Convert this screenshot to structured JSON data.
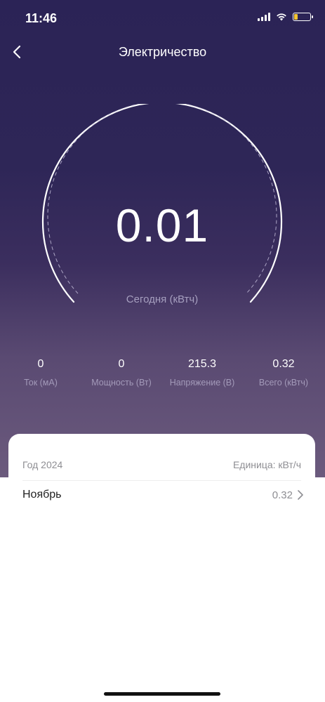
{
  "status_bar": {
    "time": "11:46",
    "icons": [
      "signal-icon",
      "wifi-icon",
      "battery-icon"
    ],
    "battery_color": "#f4c430"
  },
  "header": {
    "title": "Электричество",
    "back_icon": "chevron-left-icon"
  },
  "gauge": {
    "value": "0.01",
    "label": "Сегодня (кВтч)"
  },
  "stats": [
    {
      "value": "0",
      "label": "Ток (мА)"
    },
    {
      "value": "0",
      "label": "Мощность (Вт)"
    },
    {
      "value": "215.3",
      "label": "Напряжение (В)"
    },
    {
      "value": "0.32",
      "label": "Всего (кВтч)"
    }
  ],
  "card": {
    "year_label": "Год 2024",
    "unit_label": "Единица: кВт/ч",
    "rows": [
      {
        "label": "Ноябрь",
        "value": "0.32"
      }
    ]
  },
  "colors": {
    "background_top": "#2b2356",
    "background_bottom": "#6b5a7d",
    "accent_text": "#a69fbf"
  }
}
